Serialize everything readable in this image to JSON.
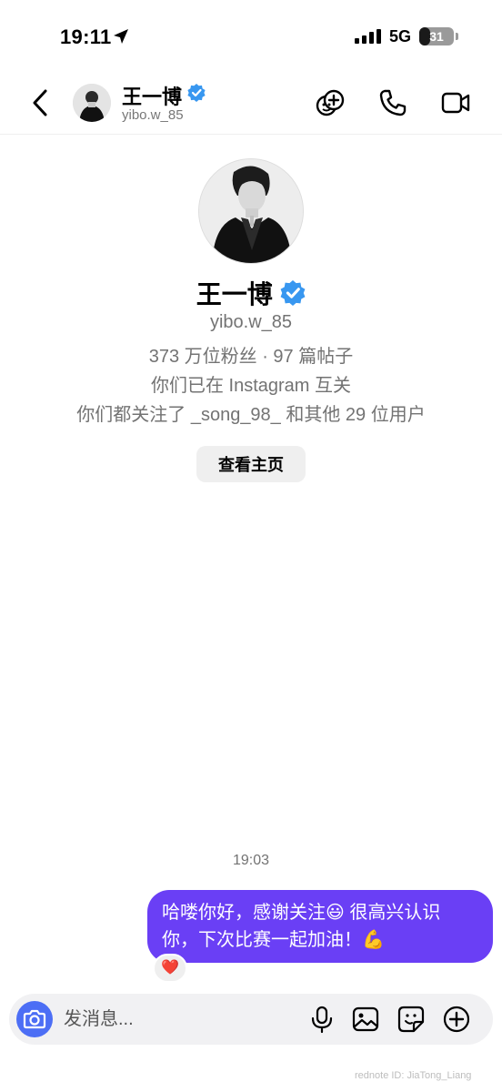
{
  "status_bar": {
    "time": "19:11",
    "network": "5G",
    "battery": "31",
    "battery_level": 0.31,
    "icons": [
      "location-arrow-icon",
      "signal-bars-icon",
      "battery-icon"
    ]
  },
  "header": {
    "name": "王一博",
    "handle": "yibo.w_85",
    "icons": [
      "back-chevron-icon",
      "verified-badge-icon",
      "group-add-icon",
      "phone-icon",
      "video-camera-icon"
    ]
  },
  "profile": {
    "name": "王一博",
    "handle": "yibo.w_85",
    "stats": "373 万位粉丝 · 97 篇帖子",
    "mutual": "你们已在 Instagram 互关",
    "followed_by": "你们都关注了 _song_98_ 和其他 29 位用户",
    "view_profile_label": "查看主页"
  },
  "messages": {
    "timestamp": "19:03",
    "items": [
      {
        "direction": "outgoing",
        "line1": "哈喽你好，感谢关注😃 很高兴认识",
        "line2": "你，下次比赛一起加油！💪",
        "reaction": "❤️"
      }
    ]
  },
  "composer": {
    "placeholder": "发消息...",
    "icons": [
      "camera-icon",
      "microphone-icon",
      "image-icon",
      "sticker-icon",
      "plus-circle-icon"
    ]
  },
  "watermark": "rednote ID: JiaTong_Liang",
  "colors": {
    "bubble": "#6a3ff5",
    "verified": "#3897f0",
    "camera_button": "#4c6ef5",
    "secondary_text": "#737373"
  }
}
